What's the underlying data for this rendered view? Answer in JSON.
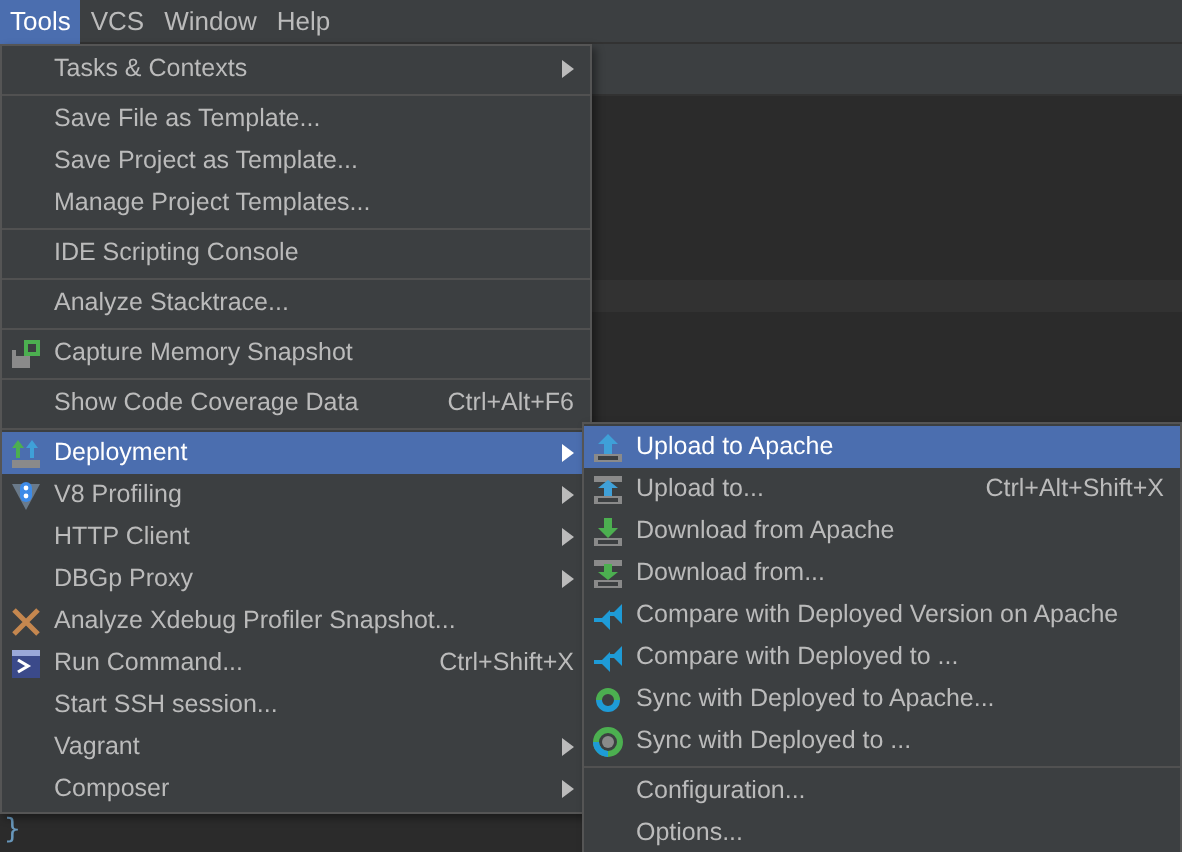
{
  "menubar": [
    {
      "label": "Tools",
      "selected": true
    },
    {
      "label": "VCS",
      "selected": false
    },
    {
      "label": "Window",
      "selected": false
    },
    {
      "label": "Help",
      "selected": false
    }
  ],
  "tools_menu": [
    {
      "kind": "item",
      "label": "Tasks & Contexts",
      "has_submenu": true,
      "selected": false
    },
    {
      "kind": "separator"
    },
    {
      "kind": "item",
      "label": "Save File as Template...",
      "selected": false
    },
    {
      "kind": "item",
      "label": "Save Project as Template...",
      "selected": false
    },
    {
      "kind": "item",
      "label": "Manage Project Templates...",
      "selected": false
    },
    {
      "kind": "separator"
    },
    {
      "kind": "item",
      "label": "IDE Scripting Console",
      "selected": false
    },
    {
      "kind": "separator"
    },
    {
      "kind": "item",
      "label": "Analyze Stacktrace...",
      "selected": false
    },
    {
      "kind": "separator"
    },
    {
      "kind": "item",
      "label": "Capture Memory Snapshot",
      "selected": false
    },
    {
      "kind": "separator"
    },
    {
      "kind": "item",
      "label": "Show Code Coverage Data",
      "shortcut": "Ctrl+Alt+F6",
      "selected": false
    },
    {
      "kind": "separator"
    },
    {
      "kind": "item",
      "label": "Deployment",
      "has_submenu": true,
      "selected": true
    },
    {
      "kind": "item",
      "label": "V8 Profiling",
      "has_submenu": true,
      "selected": false
    },
    {
      "kind": "item",
      "label": "HTTP Client",
      "has_submenu": true,
      "selected": false
    },
    {
      "kind": "item",
      "label": "DBGp Proxy",
      "has_submenu": true,
      "selected": false
    },
    {
      "kind": "item",
      "label": "Analyze Xdebug Profiler Snapshot...",
      "selected": false
    },
    {
      "kind": "item",
      "label": "Run Command...",
      "shortcut": "Ctrl+Shift+X",
      "selected": false
    },
    {
      "kind": "item",
      "label": "Start SSH session...",
      "selected": false
    },
    {
      "kind": "item",
      "label": "Vagrant",
      "has_submenu": true,
      "selected": false
    },
    {
      "kind": "item",
      "label": "Composer",
      "has_submenu": true,
      "selected": false
    }
  ],
  "deployment_submenu": [
    {
      "kind": "item",
      "label": "Upload to Apache",
      "selected": true
    },
    {
      "kind": "item",
      "label": "Upload to...",
      "shortcut": "Ctrl+Alt+Shift+X",
      "selected": false
    },
    {
      "kind": "item",
      "label": "Download from Apache",
      "selected": false
    },
    {
      "kind": "item",
      "label": "Download from...",
      "selected": false
    },
    {
      "kind": "item",
      "label": "Compare with Deployed Version on Apache",
      "selected": false
    },
    {
      "kind": "item",
      "label": "Compare with Deployed to ...",
      "selected": false
    },
    {
      "kind": "item",
      "label": "Sync with Deployed to Apache...",
      "selected": false
    },
    {
      "kind": "item",
      "label": "Sync with Deployed to ...",
      "selected": false
    },
    {
      "kind": "separator"
    },
    {
      "kind": "item",
      "label": "Configuration...",
      "selected": false
    },
    {
      "kind": "item",
      "label": "Options...",
      "selected": false
    }
  ],
  "editor_text": "}"
}
